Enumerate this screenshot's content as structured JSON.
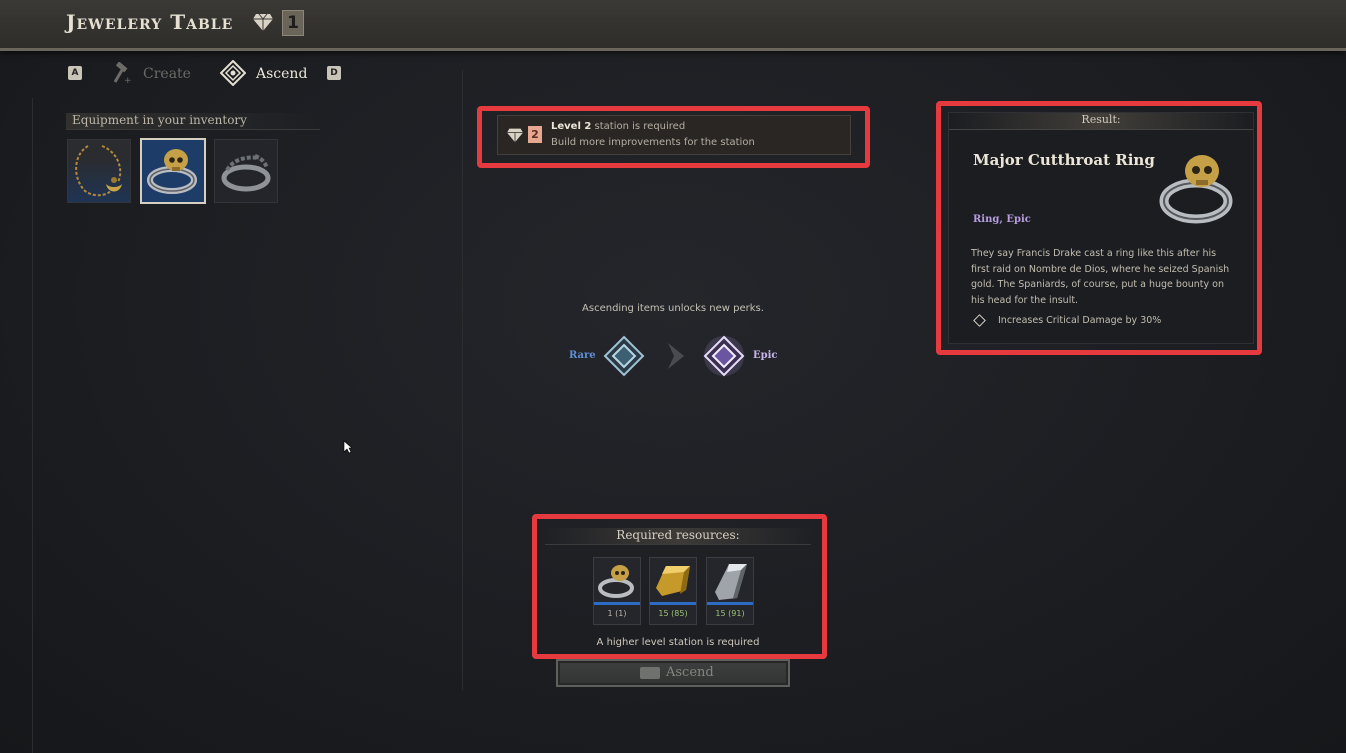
{
  "header": {
    "title": "Jewelery Table",
    "station_level": "1"
  },
  "tabs": {
    "prev_key": "A",
    "create_label": "Create",
    "ascend_label": "Ascend",
    "next_key": "D"
  },
  "inventory": {
    "heading": "Equipment in your inventory",
    "items": [
      {
        "name": "gold-pendant-necklace"
      },
      {
        "name": "skull-ring",
        "selected": true
      },
      {
        "name": "laurel-ring"
      }
    ]
  },
  "requirement": {
    "level": "2",
    "line1_bold": "Level 2",
    "line1_rest": "station is required",
    "line2": "Build more improvements for the station"
  },
  "ascension": {
    "note": "Ascending items unlocks new perks.",
    "from_rarity": "Rare",
    "to_rarity": "Epic"
  },
  "resources": {
    "heading": "Required resources:",
    "items": [
      {
        "icon": "skull-ring",
        "count": "1 (1)"
      },
      {
        "icon": "gold-ingot",
        "count": "15 (85)"
      },
      {
        "icon": "silver-ingot",
        "count": "15 (91)"
      }
    ],
    "note": "A higher level station is required"
  },
  "ascend_button": {
    "label": "Ascend"
  },
  "result": {
    "heading": "Result:",
    "name": "Major Cutthroat Ring",
    "type": "Ring, Epic",
    "description": "They say Francis Drake cast a ring like this after his first raid on Nombre de Dios, where he seized Spanish gold. The Spaniards, of course, put a huge bounty on his head for the insult.",
    "perk": "Increases Critical Damage by 30%"
  },
  "colors": {
    "highlight_red": "#e63a3f",
    "rare": "#5f8fd6",
    "epic": "#c9b7ea"
  }
}
